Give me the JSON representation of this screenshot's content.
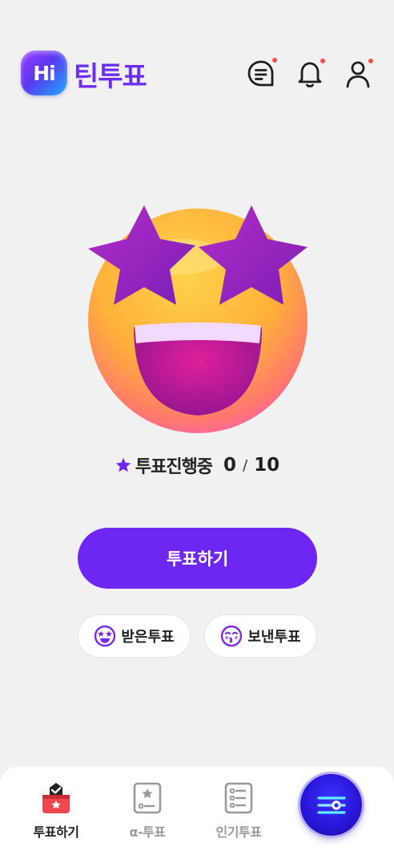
{
  "header": {
    "logo_badge": "Hi",
    "app_name": "틴투표",
    "icons": [
      "chat-list-icon",
      "bell-icon",
      "profile-icon"
    ],
    "notification_color": "#ff4b4b"
  },
  "main": {
    "emoji_icon": "star-struck-emoji",
    "status_label": "투표진행중",
    "progress_current": "0",
    "progress_separator": "/",
    "progress_total": "10",
    "vote_button": "투표하기",
    "received_button": "받은투표",
    "sent_button": "보낸투표"
  },
  "bottom_nav": {
    "items": [
      {
        "label": "투표하기",
        "icon": "ballot-box-icon",
        "active": true
      },
      {
        "label": "α-투표",
        "icon": "star-card-icon",
        "active": false
      },
      {
        "label": "인기투표",
        "icon": "list-icon",
        "active": false
      }
    ],
    "fab_icon": "settings-sliders-icon"
  },
  "colors": {
    "accent": "#6e27f3",
    "brand_text": "#6b2ff2",
    "background": "#f1f1f1",
    "inactive": "#9a9a9a"
  }
}
